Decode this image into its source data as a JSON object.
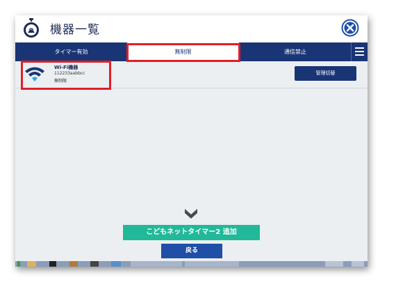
{
  "window": {
    "title": "機器一覧",
    "icons": {
      "app": "stopwatch-icon",
      "close": "close-circle-icon",
      "menu": "hamburger-menu-icon"
    }
  },
  "tabs": [
    {
      "label": "タイマー有効",
      "selected": false
    },
    {
      "label": "無制限",
      "selected": true
    },
    {
      "label": "通信禁止",
      "selected": false
    }
  ],
  "devices": [
    {
      "name": "Wi-Fi機器",
      "mac": "112233aabbcc",
      "status": "無制限",
      "icon": "wifi-icon",
      "action_label": "管理切替"
    }
  ],
  "actions": {
    "add_label": "こどもネットタイマー2 追加",
    "back_label": "戻る"
  },
  "colors": {
    "navy": "#1a3576",
    "teal": "#22b89a",
    "blue": "#1f4fa6",
    "highlight": "#e01f26",
    "background": "#eceff2"
  }
}
